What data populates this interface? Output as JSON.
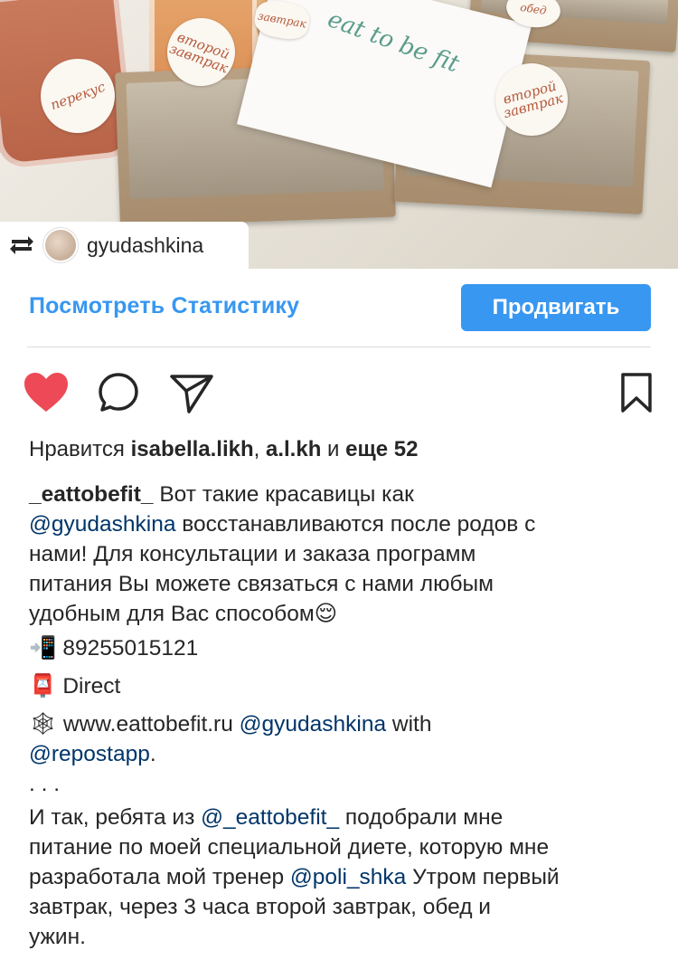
{
  "photo": {
    "repost_user": "gyudashkina",
    "card_text": "eat to be fit",
    "labels": [
      "перекус",
      "второй завтрак",
      "завтрак",
      "второй завтрак",
      "обед"
    ]
  },
  "actions": {
    "stats_link": "Посмотреть Статистику",
    "promote_button": "Продвигать"
  },
  "likes": {
    "prefix": "Нравится ",
    "user1": "isabella.likh",
    "sep": ", ",
    "user2": "a.l.kh",
    "middle": " и ",
    "more": "еще 52"
  },
  "caption": {
    "author": "_eattobefit_",
    "l1_text": " Вот такие красавицы как",
    "mention1": "@gyudashkina",
    "l2_text": "  восстанавливаются после родов с",
    "l3": "нами!  Для консультации и заказа программ",
    "l4": "питания Вы можете связаться с нами любым",
    "l5": "удобным для Вас способом😌",
    "phone_emoji": "📲",
    "phone": " 89255015121",
    "mail_emoji": "📮",
    "direct": " Direct",
    "web_emoji": "🕸",
    "website": " www.eattobefit.ru  ",
    "mention2": "@gyudashkina",
    "with": " with",
    "mention3": "@repostapp",
    "dot": ".",
    "dots": " .  .  .",
    "p2_l1a": "И так, ребята из ",
    "mention4": "@_eattobefit_",
    "p2_l1b": " подобрали мне",
    "p2_l2": "питание по моей специальной диете, которую мне",
    "p2_l3a": "разработала мой тренер ",
    "mention5": "@poli_shka",
    "p2_l3b": " Утром первый",
    "p2_l4": "завтрак, через 3 часа второй завтрак, обед и",
    "p2_l5": "ужин."
  },
  "colors": {
    "accent": "#3897f0",
    "like": "#ed4956",
    "mention": "#003569",
    "text": "#262626"
  },
  "icons": [
    "repost-icon",
    "heart-icon",
    "comment-icon",
    "share-icon",
    "bookmark-icon"
  ]
}
